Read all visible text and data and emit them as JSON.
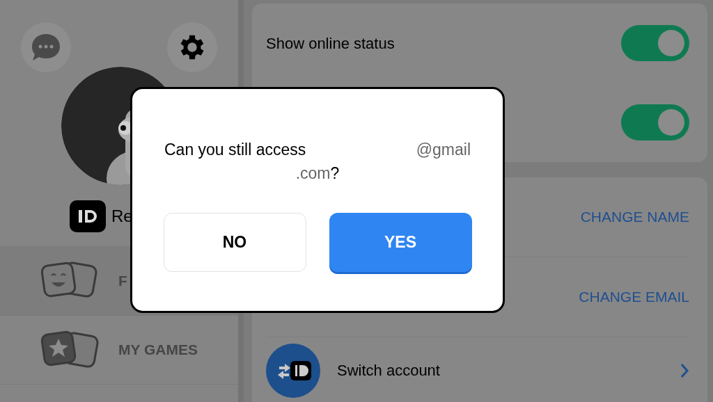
{
  "sidebar": {
    "name_partial": "Re",
    "items": [
      {
        "label": "F",
        "kind": "friends"
      },
      {
        "label": "MY GAMES",
        "kind": "games"
      }
    ]
  },
  "settings": {
    "toggles": [
      {
        "label": "Show online status",
        "on": true
      },
      {
        "on": true
      }
    ],
    "actions": [
      {
        "label": "CHANGE NAME"
      },
      {
        "label": "CHANGE EMAIL"
      }
    ],
    "switch_account": {
      "label": "Switch account"
    }
  },
  "dialog": {
    "question": "Can you still access",
    "email_start": "@gmail",
    "email_end": ".com",
    "question_mark": "?",
    "buttons": [
      {
        "label": "NO",
        "kind": "secondary"
      },
      {
        "label": "YES",
        "kind": "primary"
      }
    ]
  }
}
